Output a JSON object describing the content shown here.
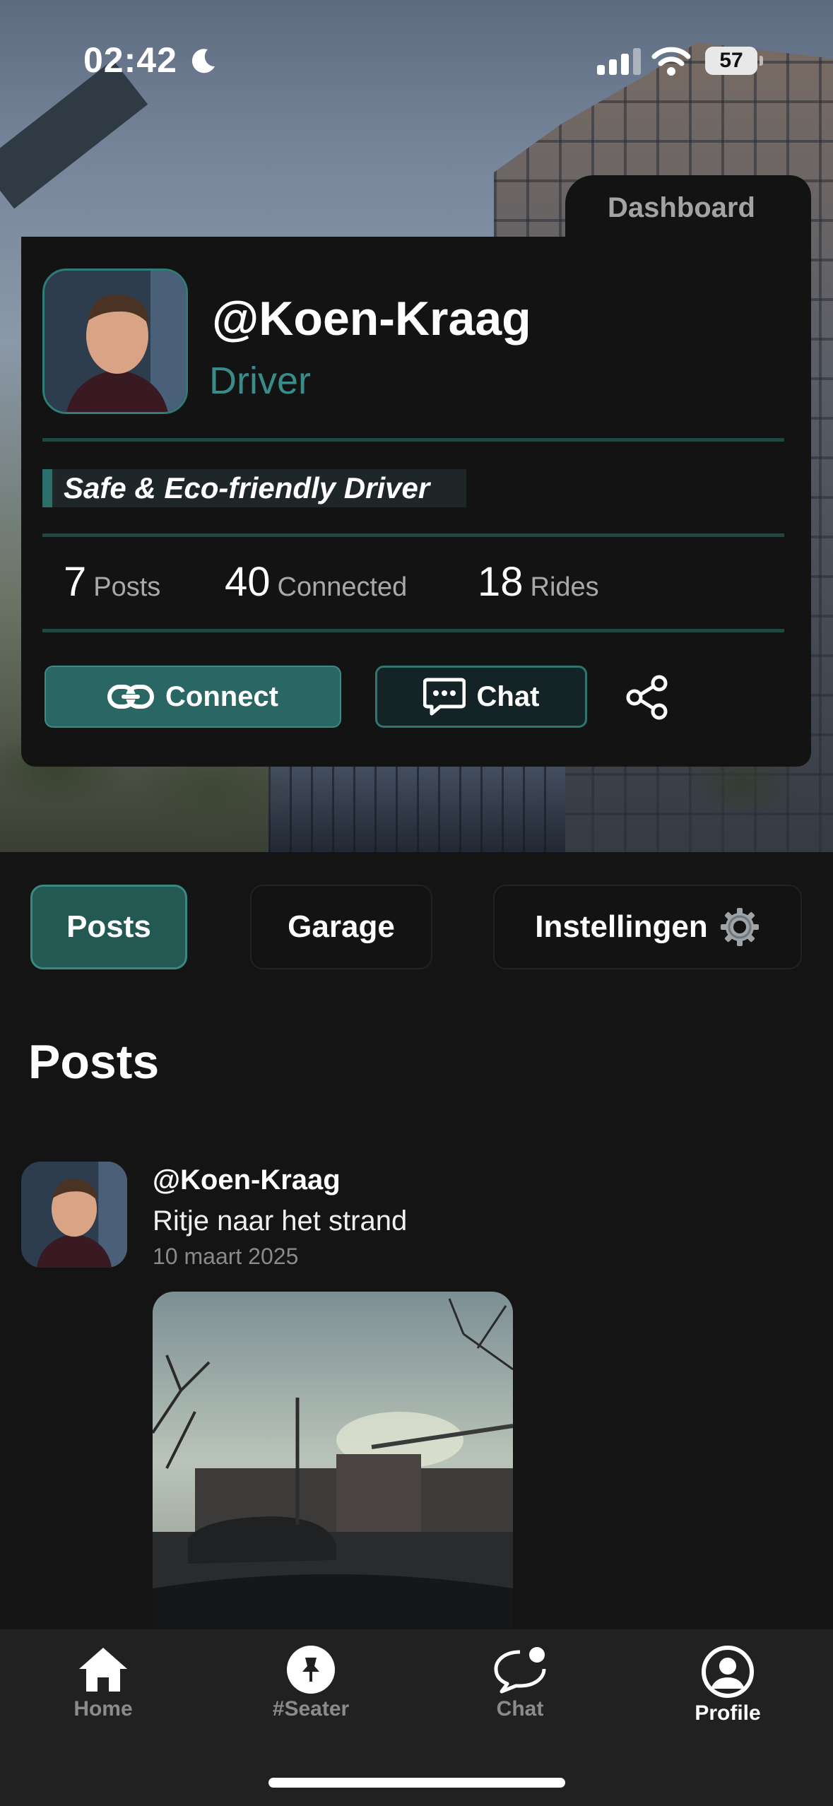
{
  "status_bar": {
    "time": "02:42",
    "battery": "57"
  },
  "profile": {
    "dashboard_label": "Dashboard",
    "username": "@Koen-Kraag",
    "role": "Driver",
    "tagline": "Safe & Eco-friendly Driver",
    "stats": [
      {
        "value": "7",
        "label": "Posts"
      },
      {
        "value": "40",
        "label": "Connected"
      },
      {
        "value": "18",
        "label": "Rides"
      }
    ],
    "connect_label": "Connect",
    "chat_label": "Chat"
  },
  "tabs": [
    {
      "label": "Posts",
      "active": true
    },
    {
      "label": "Garage",
      "active": false
    },
    {
      "label": "Instellingen",
      "active": false
    }
  ],
  "section_title": "Posts",
  "posts": [
    {
      "user": "@Koen-Kraag",
      "text": "Ritje naar het strand",
      "date": "10 maart 2025"
    }
  ],
  "bottom_nav": [
    {
      "label": "Home",
      "icon": "home-icon",
      "active": false
    },
    {
      "label": "#Seater",
      "icon": "pin-icon",
      "active": false
    },
    {
      "label": "Chat",
      "icon": "chat-bubble-icon",
      "active": false
    },
    {
      "label": "Profile",
      "icon": "profile-icon",
      "active": true
    }
  ],
  "colors": {
    "accent": "#296664",
    "accent_text": "#3a8c88",
    "background": "#141414",
    "card": "#131313"
  }
}
